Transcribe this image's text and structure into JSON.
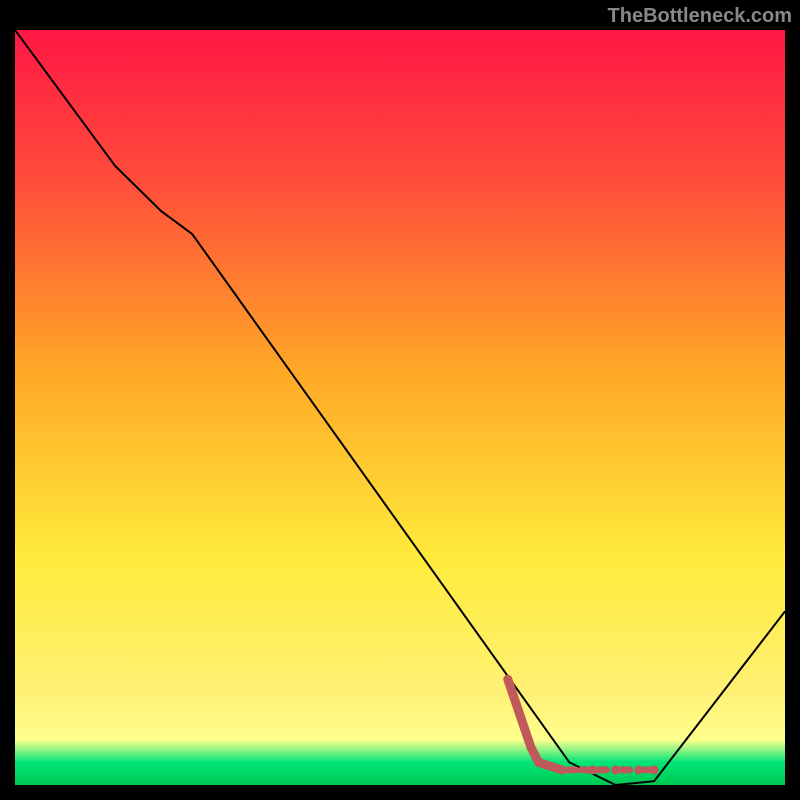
{
  "watermark": "TheBottleneck.com",
  "chart_data": {
    "type": "line",
    "title": "",
    "xlabel": "",
    "ylabel": "",
    "xlim": [
      0,
      100
    ],
    "ylim": [
      0,
      100
    ],
    "gradient_stops": [
      {
        "offset": 0,
        "color": "#ff1744"
      },
      {
        "offset": 20,
        "color": "#ff4d3a"
      },
      {
        "offset": 45,
        "color": "#ffa726"
      },
      {
        "offset": 70,
        "color": "#ffeb3b"
      },
      {
        "offset": 88,
        "color": "#fff176"
      },
      {
        "offset": 94,
        "color": "#ffff8d"
      },
      {
        "offset": 97,
        "color": "#00e676"
      },
      {
        "offset": 100,
        "color": "#00c853"
      }
    ],
    "series": [
      {
        "name": "bottleneck-curve",
        "color": "#000000",
        "points": [
          {
            "x": 0,
            "y": 100
          },
          {
            "x": 13,
            "y": 82
          },
          {
            "x": 19,
            "y": 76
          },
          {
            "x": 23,
            "y": 73
          },
          {
            "x": 65,
            "y": 13
          },
          {
            "x": 72,
            "y": 3
          },
          {
            "x": 78,
            "y": 0
          },
          {
            "x": 83,
            "y": 0.5
          },
          {
            "x": 100,
            "y": 23
          }
        ]
      }
    ],
    "dashed_segment": {
      "color": "#c05a5a",
      "points": [
        {
          "x": 64,
          "y": 14
        },
        {
          "x": 66,
          "y": 8
        },
        {
          "x": 67,
          "y": 5
        },
        {
          "x": 68,
          "y": 3
        },
        {
          "x": 71,
          "y": 2
        },
        {
          "x": 75,
          "y": 2
        },
        {
          "x": 78,
          "y": 2
        },
        {
          "x": 81,
          "y": 2
        },
        {
          "x": 83,
          "y": 2
        }
      ]
    }
  }
}
